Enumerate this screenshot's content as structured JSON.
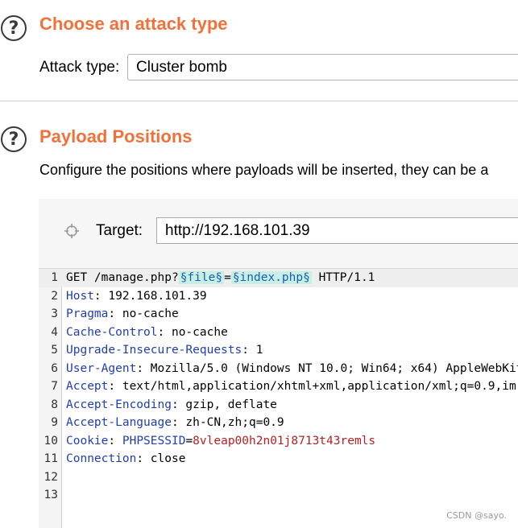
{
  "attack_section": {
    "help_icon": "help-icon",
    "title": "Choose an attack type",
    "label": "Attack type:",
    "selected": "Cluster bomb"
  },
  "payload_section": {
    "help_icon": "help-icon",
    "title": "Payload Positions",
    "description": "Configure the positions where payloads will be inserted, they can be a",
    "target_icon": "crosshair-icon",
    "target_label": "Target:",
    "target_value": "http://192.168.101.39"
  },
  "request": {
    "line1": {
      "num": "1",
      "before": "GET /manage.php?",
      "payload1": "§file§",
      "eq": "=",
      "payload2": "§index.php§",
      "after": " HTTP/1.1"
    },
    "headers": [
      {
        "num": "2",
        "name": "Host",
        "value": ": 192.168.101.39"
      },
      {
        "num": "3",
        "name": "Pragma",
        "value": ": no-cache"
      },
      {
        "num": "4",
        "name": "Cache-Control",
        "value": ": no-cache"
      },
      {
        "num": "5",
        "name": "Upgrade-Insecure-Requests",
        "value": ": 1"
      },
      {
        "num": "6",
        "name": "User-Agent",
        "value": ": Mozilla/5.0 (Windows NT 10.0; Win64; x64) AppleWebKit"
      },
      {
        "num": "7",
        "name": "Accept",
        "value": ": text/html,application/xhtml+xml,application/xml;q=0.9,im"
      },
      {
        "num": "8",
        "name": "Accept-Encoding",
        "value": ": gzip, deflate"
      },
      {
        "num": "9",
        "name": "Accept-Language",
        "value": ": zh-CN,zh;q=0.9"
      }
    ],
    "cookie": {
      "num": "10",
      "name": "Cookie",
      "sep": ": ",
      "cname": "PHPSESSID",
      "eq": "=",
      "cvalue": "8vleap00h2n01j8713t43remls"
    },
    "connection": {
      "num": "11",
      "name": "Connection",
      "value": ": close"
    },
    "empty_lines": [
      "12",
      "13"
    ]
  },
  "watermark": "CSDN @sayo.",
  "colors": {
    "title": "#f0713a",
    "header_name": "#1f3fb0",
    "cookie_value": "#b22222",
    "payload_bg": "#c7efe5"
  }
}
